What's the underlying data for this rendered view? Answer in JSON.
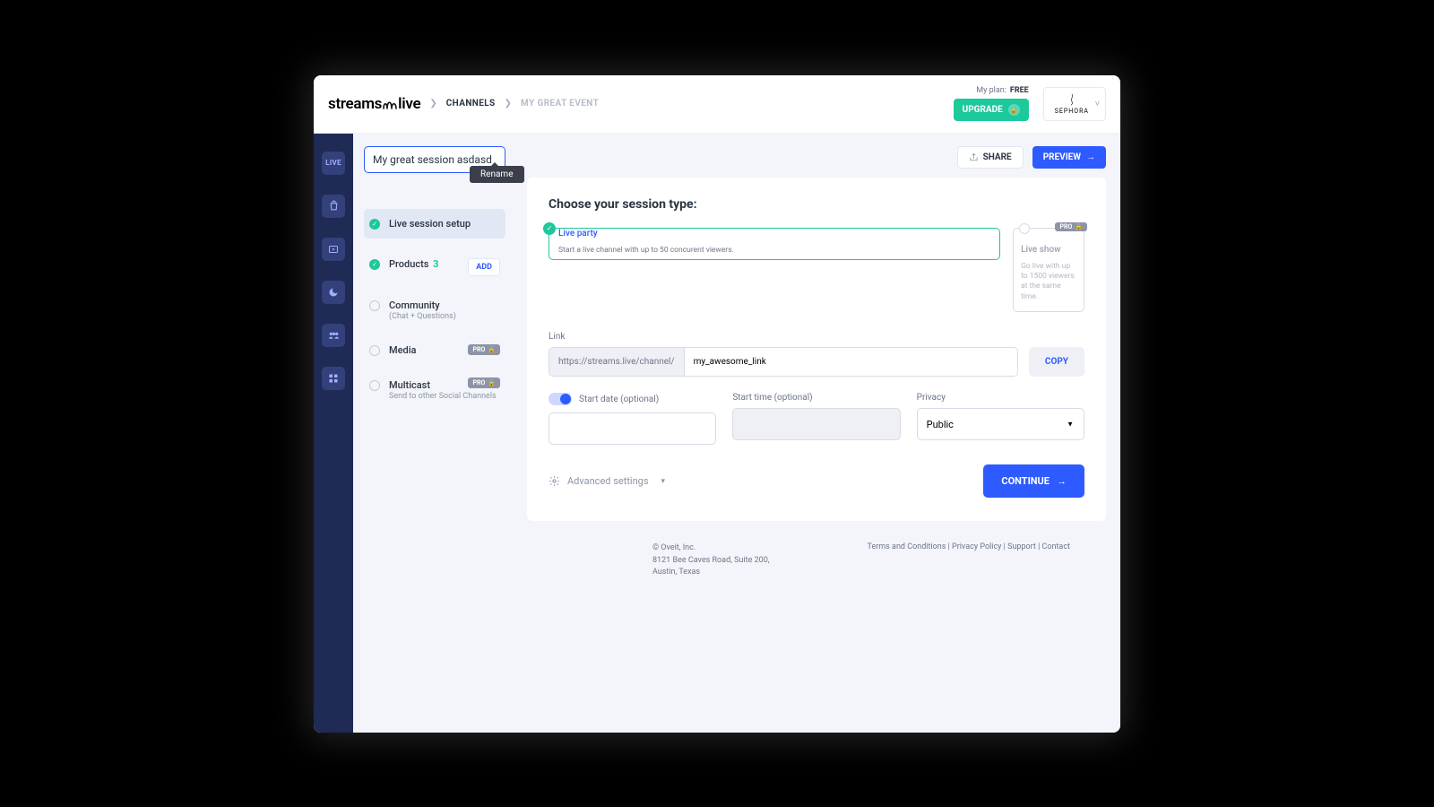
{
  "header": {
    "logo_a": "streams",
    "logo_b": "live",
    "bc1": "CHANNELS",
    "bc2": "MY GREAT EVENT",
    "plan_label": "My plan:",
    "plan_value": "FREE",
    "upgrade": "UPGRADE",
    "account": "SEPHORA"
  },
  "rail": {
    "live": "LIVE"
  },
  "side": {
    "session_name": "My great session asdasd",
    "tooltip": "Rename",
    "steps": {
      "s1": "Live session setup",
      "s2": "Products",
      "s2_count": "3",
      "s2_add": "ADD",
      "s3": "Community",
      "s3_sub": "(Chat + Questions)",
      "s4": "Media",
      "pro": "PRO",
      "s5": "Multicast",
      "s5_sub": "Send to other Social Channels"
    }
  },
  "top": {
    "share": "SHARE",
    "preview": "PREVIEW"
  },
  "panel": {
    "title": "Choose your session type:",
    "t1_title": "Live party",
    "t1_desc": "Start a live channel with up to 50 concurent viewers.",
    "t2_title": "Live show",
    "t2_desc": "Go live with up to 1500 viewers at the same time.",
    "t2_pro": "PRO",
    "link_label": "Link",
    "link_prefix": "https://streams.live/channel/",
    "link_value": "my_awesome_link",
    "copy": "COPY",
    "start_date": "Start date (optional)",
    "start_time": "Start time (optional)",
    "privacy": "Privacy",
    "privacy_value": "Public",
    "advanced": "Advanced settings",
    "continue": "CONTINUE"
  },
  "footer": {
    "c1": "© Oveit, Inc.",
    "c2": "8121 Bee Caves Road, Suite 200,",
    "c3": "Austin, Texas",
    "l1": "Terms and Conditions",
    "l2": "Privacy Policy",
    "l3": "Support",
    "l4": "Contact"
  }
}
